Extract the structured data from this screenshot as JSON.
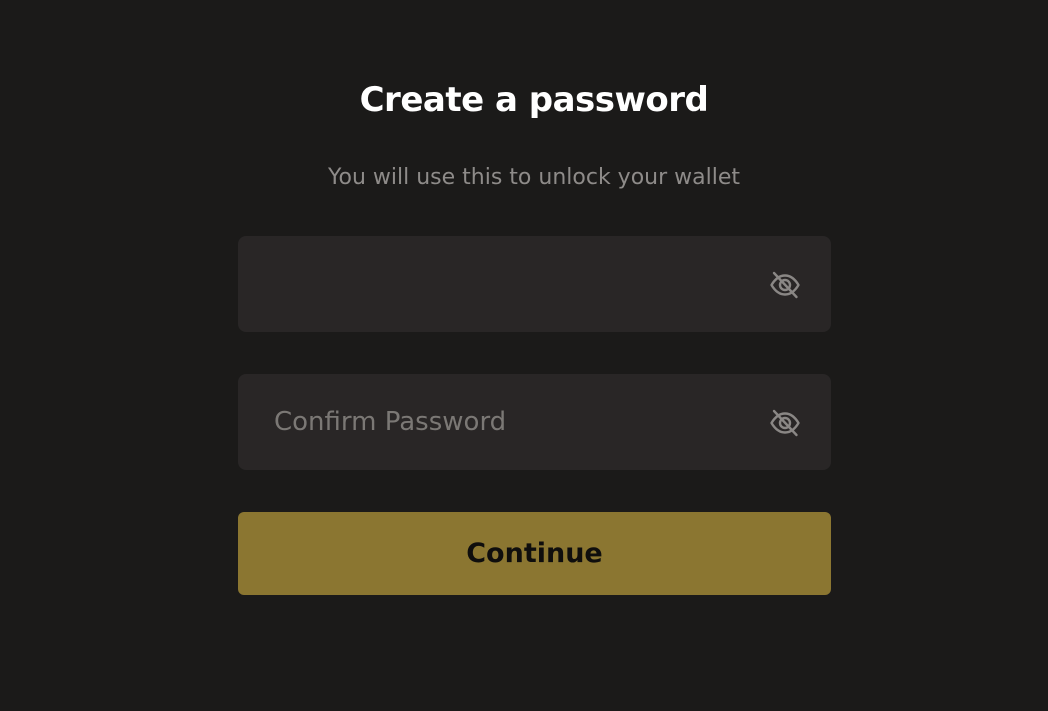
{
  "header": {
    "title": "Create a password",
    "subtitle": "You will use this to unlock your wallet"
  },
  "form": {
    "password": {
      "value": "",
      "placeholder": "",
      "toggle_icon": "eye-off-icon"
    },
    "confirm_password": {
      "value": "",
      "placeholder": "Confirm Password",
      "toggle_icon": "eye-off-icon"
    },
    "submit_label": "Continue"
  },
  "colors": {
    "background": "#1b1a19",
    "field_background": "#292626",
    "accent": "#8b7631",
    "title": "#ffffff",
    "muted_text": "#8e8b89"
  }
}
